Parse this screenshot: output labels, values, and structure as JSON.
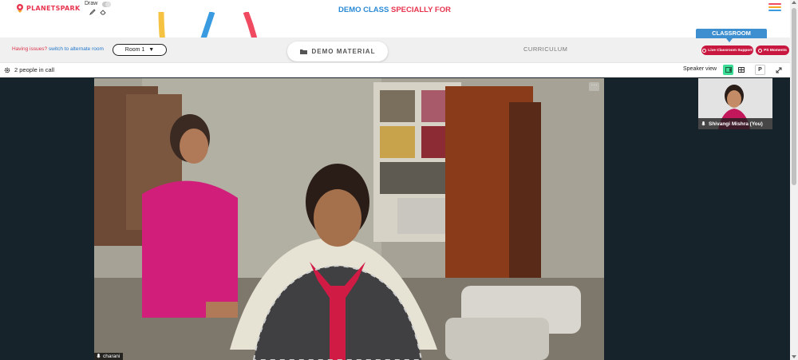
{
  "header": {
    "logo_text": "PLANETSPARK",
    "draw_label": "Draw",
    "title_part1": "DEMO CLASS",
    "title_part2": "SPECIALLY FOR",
    "icons": [
      "pencil-icon",
      "eraser-icon",
      "hamburger-menu-icon"
    ]
  },
  "toolbar": {
    "issues_text": "Having issues?",
    "alternate_link": "switch to alternate room",
    "room_label": "Room 1",
    "room_arrow": "▼",
    "demo_material_label": "DEMO MATERIAL",
    "curriculum_label": "CURRICULUM",
    "classroom_tab": "CLASSROOM",
    "support_button": "Live Classroom Support",
    "moments_button": "PS Moments"
  },
  "call": {
    "people_count": "2 people in call",
    "speaker_view_label": "Speaker view",
    "view_p_label": "P",
    "more_label": "···"
  },
  "participants": {
    "main_name": "charani",
    "self_name": "Shivangi Mishra (You)"
  },
  "colors": {
    "brand_red": "#e8344e",
    "brand_blue": "#2b8ad6",
    "accent_green": "#3ddc97",
    "stage_bg": "#17232b"
  }
}
